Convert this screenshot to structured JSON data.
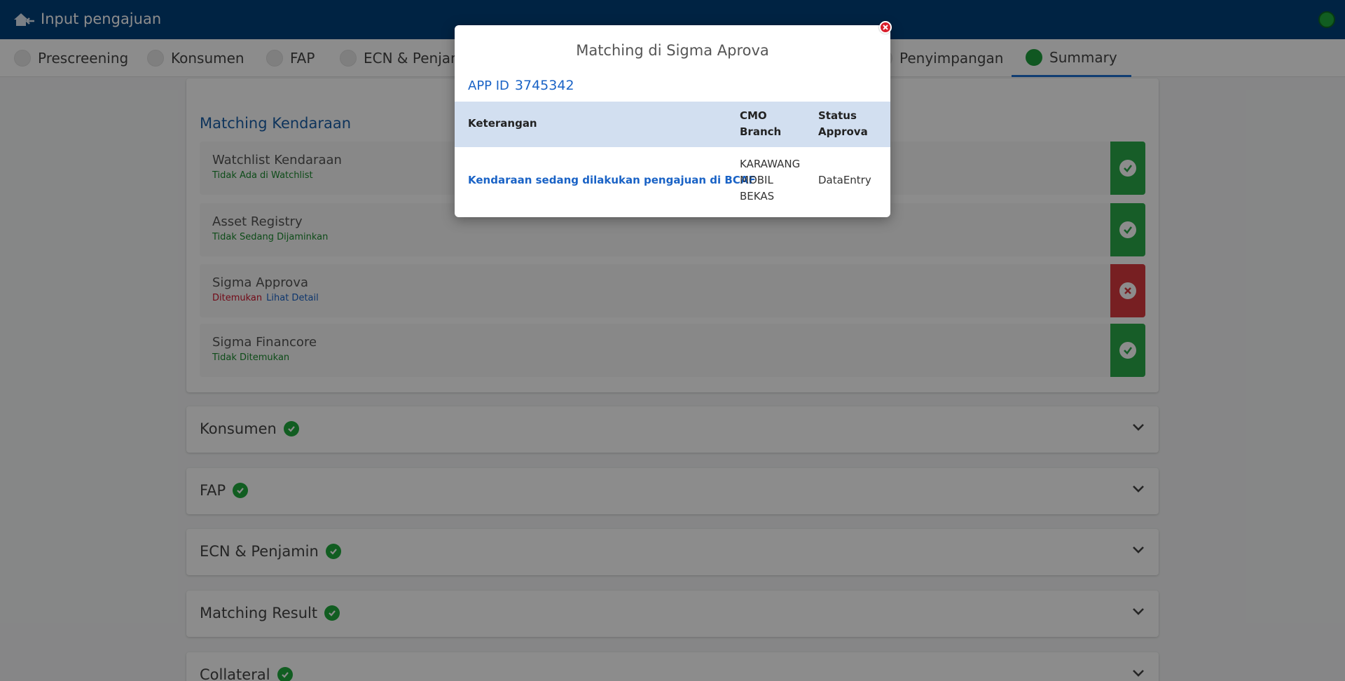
{
  "header": {
    "title": "Input pengajuan"
  },
  "tabs": [
    {
      "label": "Prescreening",
      "active": false
    },
    {
      "label": "Konsumen",
      "active": false
    },
    {
      "label": "FAP",
      "active": false
    },
    {
      "label": "ECN & Penjam",
      "active": false
    },
    {
      "label": "Penyimpangan",
      "active": false
    },
    {
      "label": "Summary",
      "active": true
    }
  ],
  "matching": {
    "title": "Matching Kendaraan",
    "rows": [
      {
        "title": "Watchlist Kendaraan",
        "status_text": "Tidak Ada di Watchlist",
        "status": "ok",
        "link": ""
      },
      {
        "title": "Asset Registry",
        "status_text": "Tidak Sedang Dijaminkan",
        "status": "ok",
        "link": ""
      },
      {
        "title": "Sigma Approva",
        "status_text": "Ditemukan",
        "status": "bad",
        "link": "Lihat Detail"
      },
      {
        "title": "Sigma Financore",
        "status_text": "Tidak Ditemukan",
        "status": "ok",
        "link": ""
      }
    ]
  },
  "sections": [
    {
      "title": "Konsumen"
    },
    {
      "title": "FAP"
    },
    {
      "title": "ECN & Penjamin"
    },
    {
      "title": "Matching Result"
    },
    {
      "title": "Collateral"
    }
  ],
  "modal": {
    "title": "Matching di Sigma Aprova",
    "app_id_label": "APP ID",
    "app_id_value": "3745342",
    "columns": [
      "Keterangan",
      "CMO Branch",
      "Status Approva"
    ],
    "row": {
      "keterangan": "Kendaraan sedang dilakukan pengajuan di BCAF",
      "cmo_branch": "KARAWANG MOBIL BEKAS",
      "status": "DataEntry"
    }
  },
  "colors": {
    "header_bg": "#00407a",
    "ok_green": "#2aa94a",
    "bad_red": "#d93a3f",
    "link_blue": "#1a63c6",
    "table_head_bg": "#d2dff0"
  },
  "icons": {
    "home": "home-back-icon",
    "ok": "check-circle-icon",
    "bad": "x-circle-icon",
    "collapse": "chevron-down-icon",
    "close": "close-icon"
  }
}
